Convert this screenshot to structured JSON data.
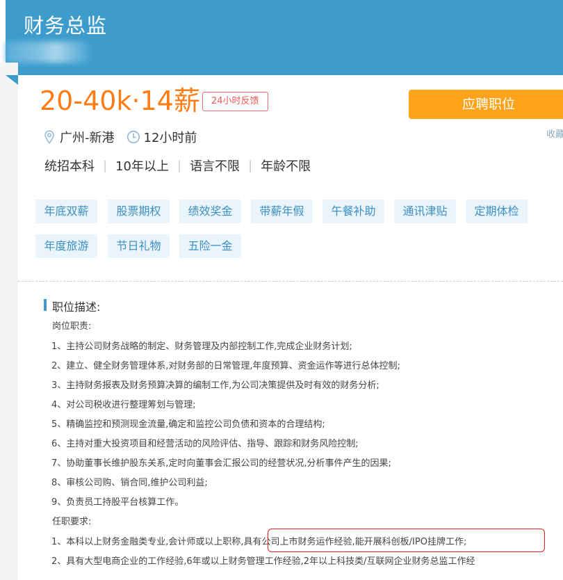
{
  "job": {
    "title": "财务总监",
    "salary": "20-40k·14薪",
    "feedback_badge": "24小时反馈",
    "apply_button": "应聘职位",
    "favorite_link": "收藏",
    "location": "广州-新港",
    "posted": "12小时前",
    "requirements": [
      "统招本科",
      "10年以上",
      "语言不限",
      "年龄不限"
    ],
    "benefits": [
      "年底双薪",
      "股票期权",
      "绩效奖金",
      "带薪年假",
      "午餐补助",
      "通讯津贴",
      "定期体检",
      "年度旅游",
      "节日礼物",
      "五险一金"
    ]
  },
  "description": {
    "section_title": "职位描述:",
    "duties_heading": "岗位职责:",
    "duties": [
      "1、主持公司财务战略的制定、财务管理及内部控制工作,完成企业财务计划;",
      "2、建立、健全财务管理体系,对财务部的日常管理,年度预算、资金运作等进行总体控制;",
      "3、主持财务报表及财务预算决算的编制工作,为公司决策提供及时有效的财务分析;",
      "4、对公司税收进行整理筹划与管理;",
      "5、精确监控和预测现金流量,确定和监控公司负债和资本的合理结构;",
      "6、主持对重大投资项目和经营活动的风险评估、指导、跟踪和财务风险控制;",
      "7、协助董事长维护股东关系,定时向董事会汇报公司的经营状况,分析事件产生的因果;",
      "8、审核公司购、销合同,维护公司利益;",
      "9、负责员工持股平台核算工作。"
    ],
    "qualifications_heading": "任职要求:",
    "qualifications": [
      "1、本科以上财务金融类专业,会计师或以上职称,具有公司上市财务运作经验,能开展科创板/IPO挂牌工作;",
      "2、具有大型电商企业的工作经验,6年或以上财务管理工作经验,2年以上科技类/互联网企业财务总监工作经"
    ]
  },
  "colors": {
    "header": "#3d9ccc",
    "salary": "#ff7c14",
    "apply_button": "#ffa31a",
    "tag_bg": "#e9f4fb",
    "tag_text": "#3d8fc4",
    "highlight_border": "#e02020"
  },
  "icons": {
    "location": "location-pin-icon",
    "time": "clock-icon"
  }
}
